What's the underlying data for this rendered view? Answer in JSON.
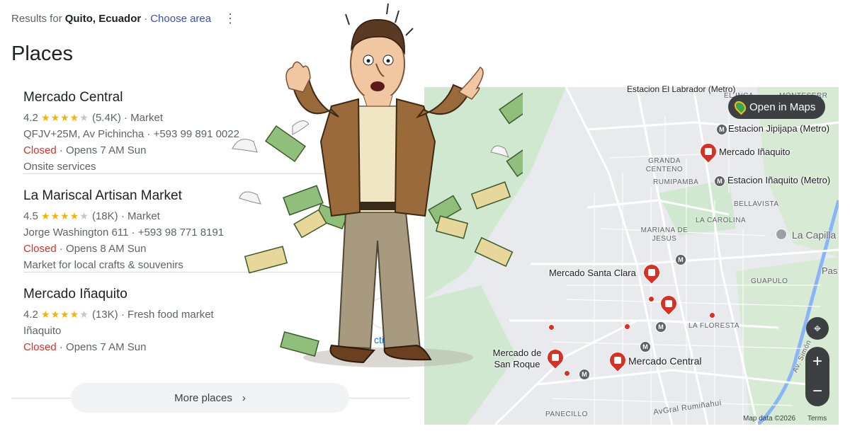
{
  "header": {
    "prefix": "Results for",
    "location": "Quito, Ecuador",
    "separator": "·",
    "choose_area": "Choose area",
    "menu_icon": "more-vert-icon"
  },
  "title": "Places",
  "places": [
    {
      "name": "Mercado Central",
      "rating": "4.2",
      "stars": 4.2,
      "reviews": "(5.4K)",
      "category": "Market",
      "address": "QFJV+25M, Av Pichincha",
      "phone": "+593 99 891 0022",
      "status": "Closed",
      "opens": "Opens 7 AM Sun",
      "extra": "Onsite services"
    },
    {
      "name": "La Mariscal Artisan Market",
      "rating": "4.5",
      "stars": 4.5,
      "reviews": "(18K)",
      "category": "Market",
      "address": "Jorge Washington 611",
      "phone": "+593 98 771 8191",
      "status": "Closed",
      "opens": "Opens 8 AM Sun",
      "extra": "Market for local crafts & souvenirs"
    },
    {
      "name": "Mercado Iñaquito",
      "rating": "4.2",
      "stars": 4.2,
      "reviews": "(13K)",
      "category": "Fresh food market",
      "address": "Iñaquito",
      "phone": "",
      "status": "Closed",
      "opens": "Opens 7 AM Sun",
      "extra": ""
    }
  ],
  "more_places": "More places",
  "directions_partial": "ction",
  "map": {
    "open_in_maps": "Open in Maps",
    "labels": {
      "estacion_labrador": "Estacion El Labrador (Metro)",
      "el_inca": "EL INCA",
      "monteserrin": "MONTESERR",
      "estacion_jipijapa": "Estacion Jipijapa (Metro)",
      "mercado_inaquito": "Mercado Iñaquito",
      "grand_centeno": "GRANDA CENTENO",
      "rumipamba": "RUMIPAMBA",
      "estacion_inaquito": "Estacion Iñaquito (Metro)",
      "bellavista": "BELLAVISTA",
      "la_carolina": "LA CAROLINA",
      "mariana_de_jesus": "MARIANA DE JESUS",
      "la_capilla": "La Capilla",
      "mercado_santa_clara": "Mercado Santa Clara",
      "pas": "Pas",
      "guapulo": "GUAPULO",
      "la_floresta": "LA FLORESTA",
      "mercado_san_roque": "Mercado de San Roque",
      "mercado_central": "Mercado Central",
      "av_simon": "Av. Simón",
      "av_gral_rumi": "AvGral Rumiñahui",
      "panecillo": "PANECILLO",
      "map_data": "Map data ©2026",
      "terms": "Terms"
    },
    "metro_glyph": "M",
    "colors": {
      "water": "#8ab4f8",
      "park": "#c8e6c9",
      "road": "#ffffff",
      "pin": "#d93025"
    }
  }
}
